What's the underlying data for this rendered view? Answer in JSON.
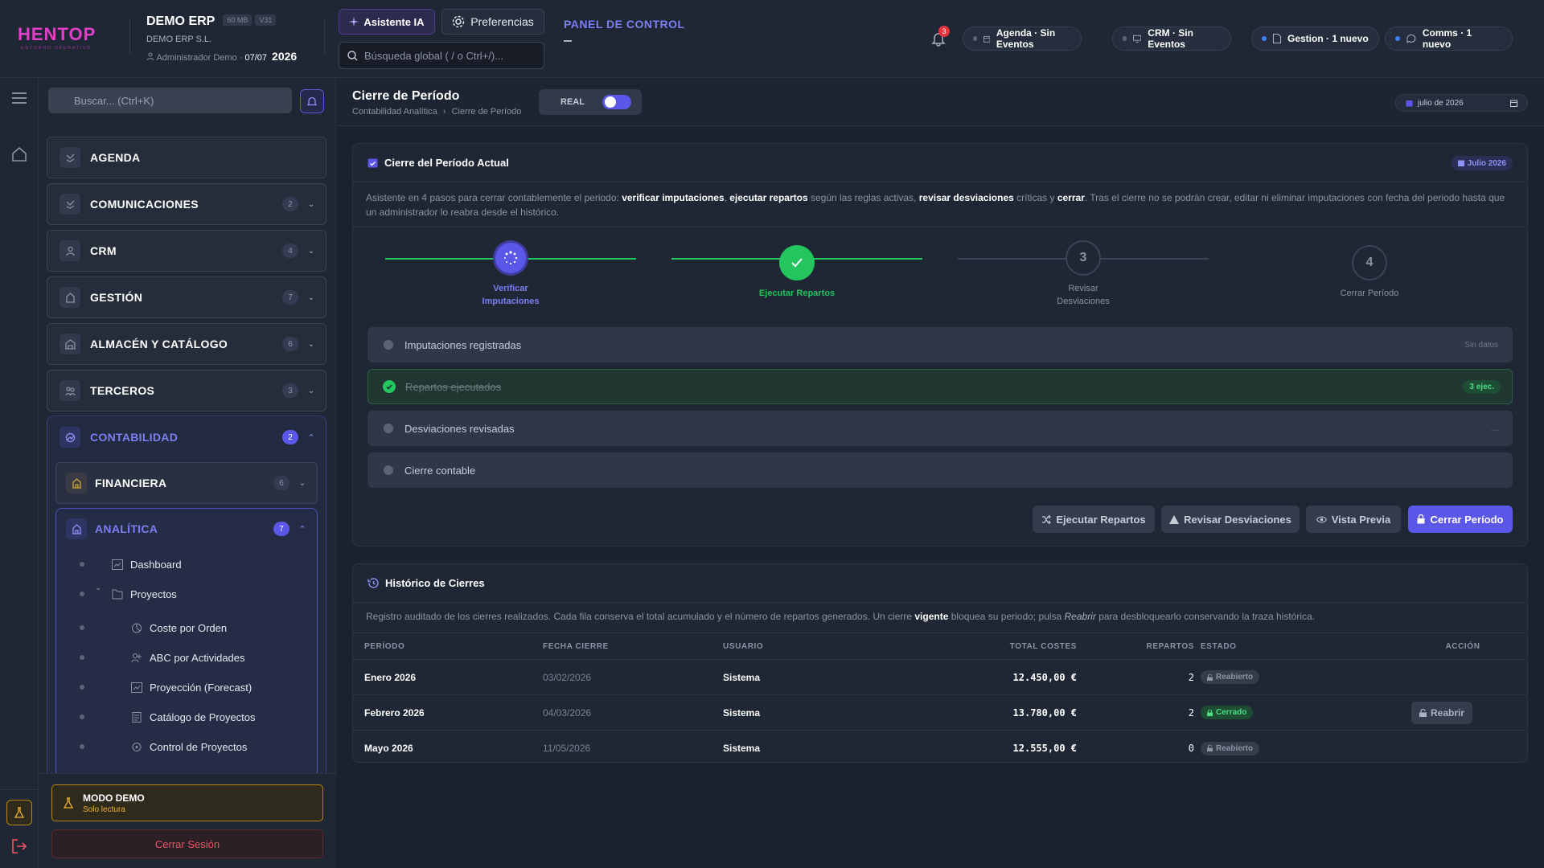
{
  "colors": {
    "accent": "#5b57e8",
    "accent_text": "#7b7ff4",
    "success": "#22c55e",
    "danger": "#e5343f",
    "warning": "#f1b232",
    "bg": "#1b212d"
  },
  "header": {
    "logo_text": "HENTOP",
    "logo_tagline": "ENTORNO OPERATIVO",
    "company": "DEMO ERP",
    "size_badge": "60 MB",
    "version_badge": "V31",
    "legal_name": "DEMO ERP S.L.",
    "user": "Administrador Demo",
    "date": "07/07",
    "year": "2026",
    "ai_button": "Asistente IA",
    "prefs_button": "Preferencias",
    "search_placeholder": "Búsqueda global ( / o Ctrl+/)...",
    "panel_title": "PANEL DE CONTROL",
    "notif_count": "3",
    "pills": [
      {
        "label": "Agenda · Sin Eventos",
        "icon": "calendar-icon",
        "active": false
      },
      {
        "label": "CRM · Sin Eventos",
        "icon": "monitor-icon",
        "active": false
      },
      {
        "label": "Gestion · 1 nuevo",
        "icon": "document-icon",
        "active": true
      },
      {
        "label": "Comms · 1 nuevo",
        "icon": "chat-icon",
        "active": true
      }
    ]
  },
  "sidebar": {
    "search_placeholder": "Buscar... (Ctrl+K)",
    "items": [
      {
        "label": "AGENDA",
        "count": "",
        "expandable": false
      },
      {
        "label": "COMUNICACIONES",
        "count": "2",
        "expandable": true
      },
      {
        "label": "CRM",
        "count": "4",
        "expandable": true
      },
      {
        "label": "GESTIÓN",
        "count": "7",
        "expandable": true
      },
      {
        "label": "ALMACÉN Y CATÁLOGO",
        "count": "6",
        "expandable": true
      },
      {
        "label": "TERCEROS",
        "count": "3",
        "expandable": true
      }
    ],
    "contabilidad": {
      "label": "CONTABILIDAD",
      "count": "2"
    },
    "financiera": {
      "label": "FINANCIERA",
      "count": "6"
    },
    "analitica": {
      "label": "ANALÍTICA",
      "count": "7"
    },
    "analitica_items": {
      "dashboard": "Dashboard",
      "proyectos": "Proyectos",
      "coste": "Coste por Orden",
      "abc": "ABC por Actividades",
      "forecast": "Proyección (Forecast)",
      "catalogo": "Catálogo de Proyectos",
      "control": "Control de Proyectos"
    },
    "demo_title": "MODO DEMO",
    "demo_sub": "Solo lectura",
    "logout": "Cerrar Sesión"
  },
  "page": {
    "title": "Cierre de Período",
    "crumb_1": "Contabilidad Analítica",
    "crumb_2": "Cierre de Período",
    "mode_label": "REAL",
    "mode_on": true,
    "date_filter": "julio de 2026"
  },
  "wizard": {
    "title": "Cierre del Período Actual",
    "chip": "Julio 2026",
    "intro": {
      "t1": "Asistente en 4 pasos para cerrar contablemente el periodo: ",
      "b1": "verificar imputaciones",
      "t2": ", ",
      "b2": "ejecutar repartos",
      "t3": " según las reglas activas, ",
      "b3": "revisar desviaciones",
      "t4": " críticas y ",
      "b4": "cerrar",
      "t5": ". Tras el cierre no se podrán crear, editar ni eliminar imputaciones con fecha del periodo hasta que un administrador lo reabra desde el histórico."
    },
    "steps": [
      {
        "num": "1",
        "l1": "Verificar",
        "l2": "Imputaciones",
        "state": "loading"
      },
      {
        "num": "2",
        "l1": "Ejecutar Repartos",
        "l2": "",
        "state": "done"
      },
      {
        "num": "3",
        "l1": "Revisar",
        "l2": "Desviaciones",
        "state": "pending"
      },
      {
        "num": "4",
        "l1": "Cerrar Período",
        "l2": "",
        "state": "pending"
      }
    ],
    "checks": [
      {
        "label": "Imputaciones registradas",
        "right": "Sin datos",
        "done": false
      },
      {
        "label": "Repartos ejecutados",
        "right": "3 ejec.",
        "done": true
      },
      {
        "label": "Desviaciones revisadas",
        "right": "...",
        "done": false
      },
      {
        "label": "Cierre contable",
        "right": "",
        "done": false
      }
    ],
    "actions": {
      "repartos": "Ejecutar Repartos",
      "desviaciones": "Revisar Desviaciones",
      "preview": "Vista Previa",
      "cerrar": "Cerrar Período"
    }
  },
  "history": {
    "title": "Histórico de Cierres",
    "intro": {
      "t1": "Registro auditado de los cierres realizados. Cada fila conserva el total acumulado y el número de repartos generados. Un cierre ",
      "b1": "vigente",
      "t2": " bloquea su periodo; pulsa ",
      "i1": "Reabrir",
      "t3": " para desbloquearlo conservando la traza histórica."
    },
    "columns": {
      "periodo": "PERÍODO",
      "fecha": "FECHA CIERRE",
      "usuario": "USUARIO",
      "total": "TOTAL COSTES",
      "repartos": "REPARTOS",
      "estado": "ESTADO",
      "accion": "ACCIÓN"
    },
    "rows": [
      {
        "periodo": "Enero 2026",
        "fecha": "03/02/2026",
        "usuario": "Sistema",
        "total": "12.450,00 €",
        "repartos": "2",
        "estado": "Reabierto",
        "accion": ""
      },
      {
        "periodo": "Febrero 2026",
        "fecha": "04/03/2026",
        "usuario": "Sistema",
        "total": "13.780,00 €",
        "repartos": "2",
        "estado": "Cerrado",
        "accion": "Reabrir"
      },
      {
        "periodo": "Mayo 2026",
        "fecha": "11/05/2026",
        "usuario": "Sistema",
        "total": "12.555,00 €",
        "repartos": "0",
        "estado": "Reabierto",
        "accion": ""
      }
    ]
  }
}
